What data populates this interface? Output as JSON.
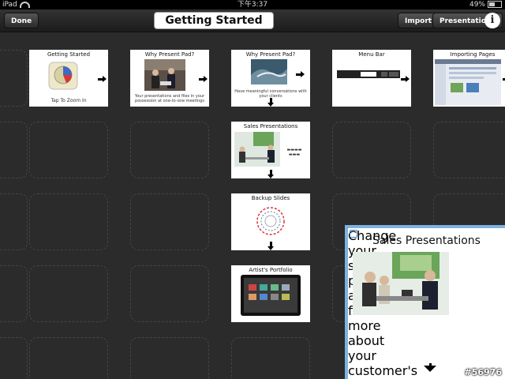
{
  "status": {
    "carrier": "iPad",
    "time": "下午3:37",
    "battery": "49%"
  },
  "toolbar": {
    "done": "Done",
    "title": "Getting Started",
    "import": "Import",
    "presentations": "Presentations",
    "info": "i"
  },
  "slides": {
    "getting_started": {
      "title": "Getting Started",
      "caption": "Tap To Zoom In"
    },
    "why1": {
      "title": "Why Present Pad?",
      "caption": "Your presentations and files in your possession at one-to-one meetings"
    },
    "why2": {
      "title": "Why Present Pad?",
      "caption": "Have meaningful conversations with your clients"
    },
    "menu_bar": {
      "title": "Menu Bar"
    },
    "importing": {
      "title": "Importing Pages"
    },
    "sales": {
      "title": "Sales Presentations"
    },
    "backup": {
      "title": "Backup Slides"
    },
    "portfolio": {
      "title": "Artist's Portfolio"
    }
  },
  "zoomed": {
    "title": "Sales Presentations",
    "caption": "Change your sales presentation as you find out more about your customer's needs."
  },
  "watermark": "#56976"
}
